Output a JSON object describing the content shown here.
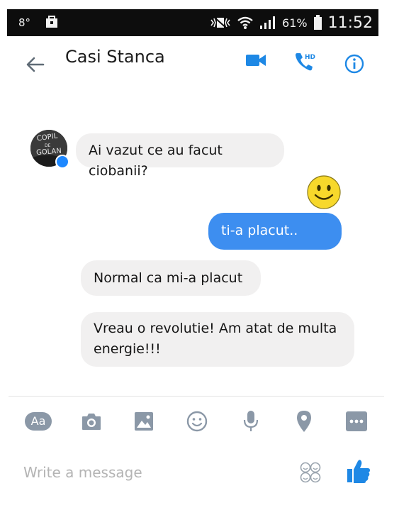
{
  "status_bar": {
    "temperature": "8°",
    "battery_percent": "61%",
    "time": "11:52"
  },
  "header": {
    "contact_name": "Casi Stanca",
    "icons": [
      "back-arrow-icon",
      "video-call-icon",
      "hd-voice-call-icon",
      "info-icon"
    ],
    "accent_color": "#1e88e5"
  },
  "messages": [
    {
      "direction": "incoming",
      "text": "Ai vazut ce au facut ciobanii?"
    },
    {
      "direction": "outgoing",
      "type": "emoji",
      "emoji": "smiley-emoji"
    },
    {
      "direction": "outgoing",
      "text": "ti-a placut.."
    },
    {
      "direction": "incoming",
      "text": "Normal ca mi-a placut"
    },
    {
      "direction": "incoming",
      "text": "Vreau o revolutie! Am atat de multa energie!!!"
    }
  ],
  "avatar": {
    "text": "COPIL DE GOLAN"
  },
  "toolbar": {
    "aa_label": "Aa",
    "icons": [
      "text-style-icon",
      "camera-icon",
      "gallery-icon",
      "emoji-icon",
      "microphone-icon",
      "location-icon",
      "more-icon"
    ]
  },
  "composer": {
    "placeholder": "Write a message",
    "value": ""
  },
  "colors": {
    "outgoing_bubble": "#3d8ef0",
    "incoming_bubble": "#f1f0f0",
    "toolbar_icon": "#8b98a7"
  }
}
